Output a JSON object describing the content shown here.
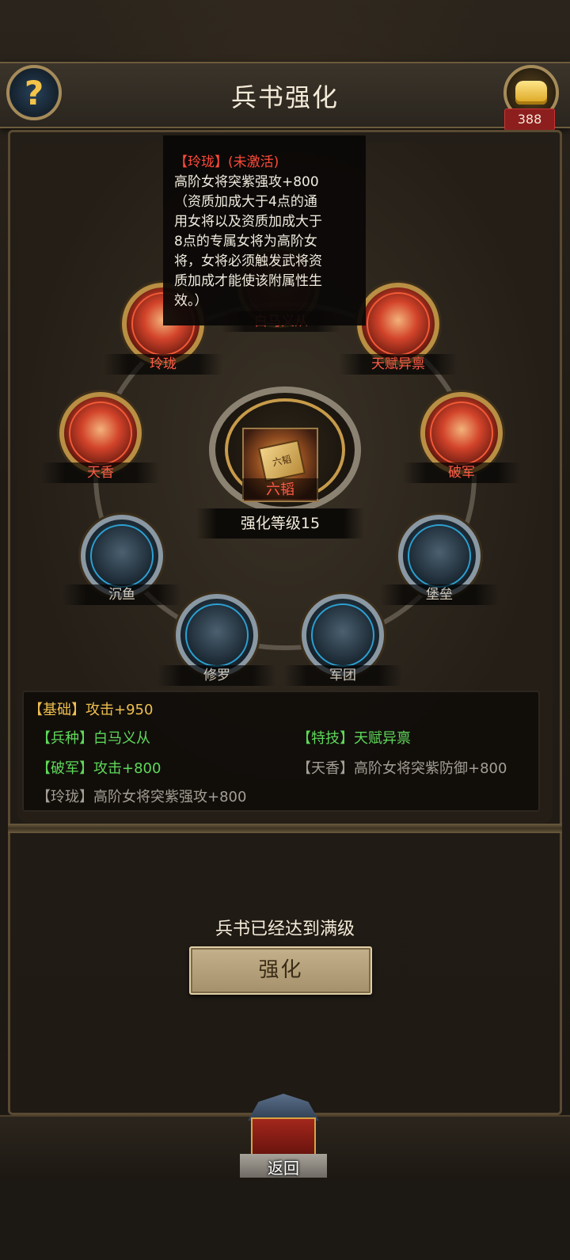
{
  "header": {
    "title": "兵书强化",
    "help_icon": "?",
    "gold_count": "388"
  },
  "tooltip": {
    "title": "【玲珑】(未激活)",
    "lines": [
      "高阶女将突紫强攻+800",
      "（资质加成大于4点的通",
      "用女将以及资质加成大于",
      "8点的专属女将为高阶女",
      "将，女将必须触发武将资",
      "质加成才能使该附属性生",
      "效。）"
    ]
  },
  "center": {
    "book_label": "六韬",
    "book_glyph": "六韬",
    "level_text": "强化等级15"
  },
  "nodes": {
    "top": "白马义从",
    "top_left": "玲珑",
    "top_right": "天赋异禀",
    "left": "天香",
    "right": "破军",
    "mid_left": "沉鱼",
    "mid_right": "堡垒",
    "bottom_left": "修罗",
    "bottom_right": "军团"
  },
  "stats": {
    "base_key": "【基础】",
    "base_val": "攻击+950",
    "unit_key": "【兵种】",
    "unit_val": "白马义从",
    "skill_key": "【特技】",
    "skill_val": "天赋异禀",
    "pojun_key": "【破军】",
    "pojun_val": "攻击+800",
    "tianxiang_key": "【天香】",
    "tianxiang_val": "高阶女将突紫防御+800",
    "linglong_key": "【玲珑】",
    "linglong_val": "高阶女将突紫强攻+800"
  },
  "footer": {
    "max_text": "兵书已经达到满级",
    "enhance_label": "强化",
    "back_label": "返回"
  },
  "colors": {
    "active_red": "#ff5b47",
    "gold": "#efbf4f",
    "green": "#5fd85a",
    "gray": "#a49e94"
  }
}
